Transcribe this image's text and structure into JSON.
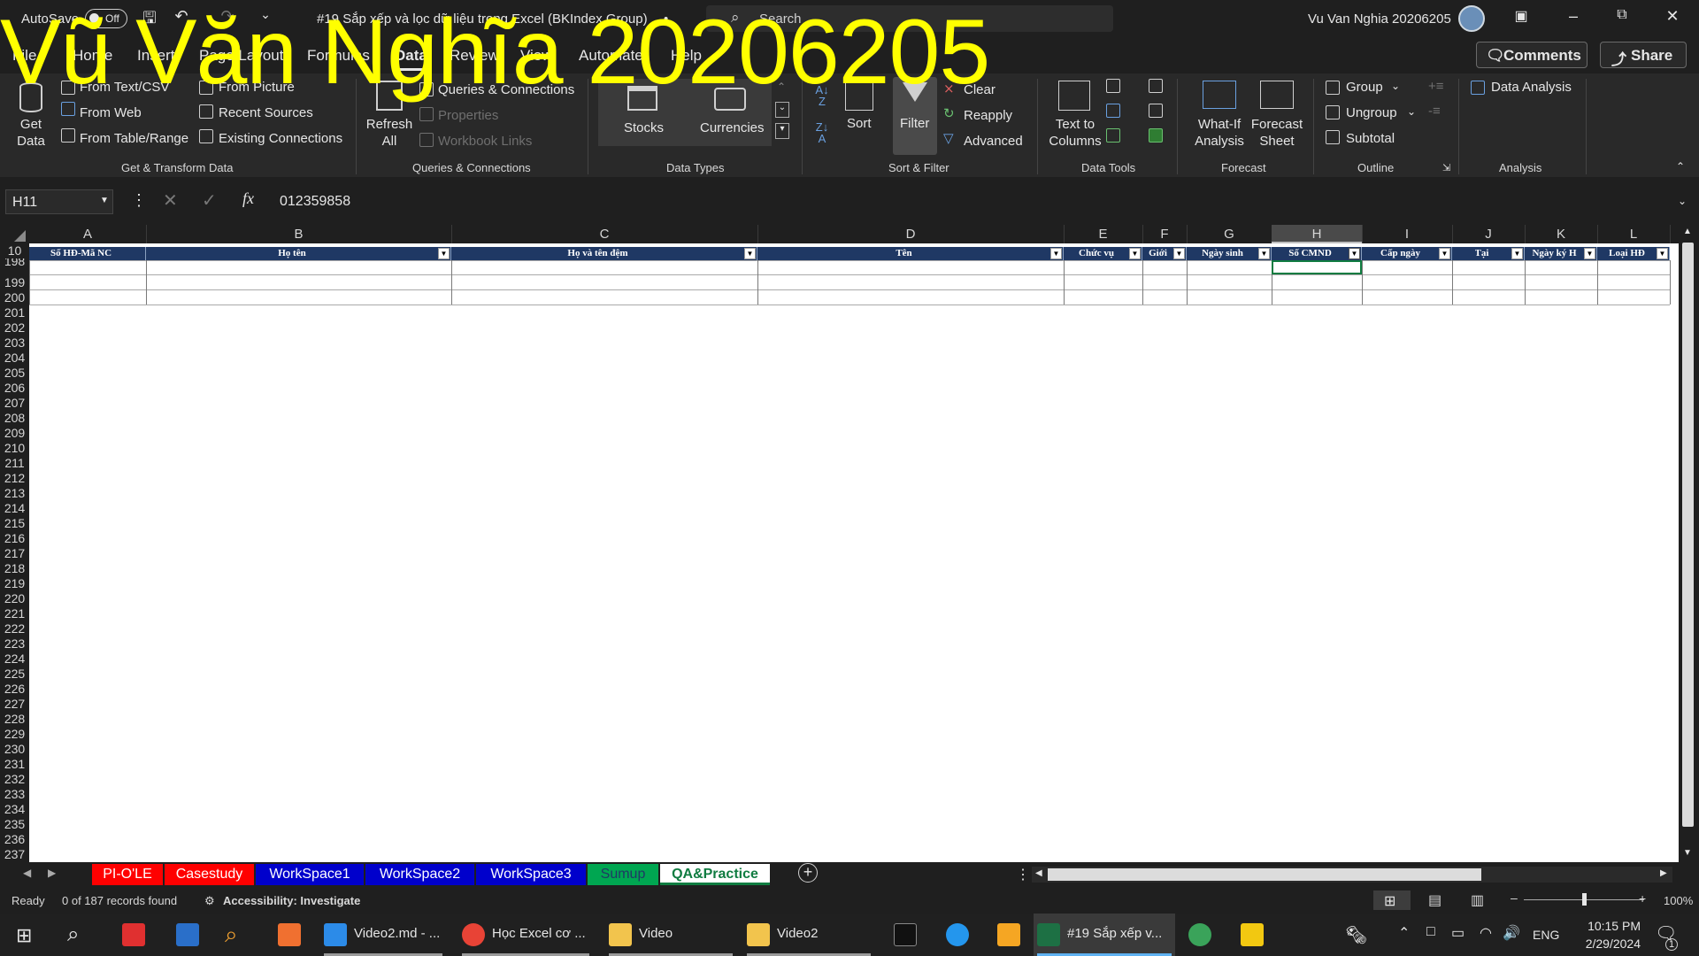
{
  "title_bar": {
    "autosave_label": "AutoSave",
    "autosave_state": "Off",
    "document_title": "#19 Sắp xếp và lọc dữ liệu trong Excel (BKIndex Group)",
    "saved_indicator": "•",
    "search_placeholder": "Search",
    "user_name": "Vu Van Nghia 20206205",
    "icons": [
      "save-icon",
      "undo-icon",
      "redo-icon",
      "customize-icon",
      "ribbon-display-icon",
      "minimize-icon",
      "restore-icon",
      "close-icon"
    ]
  },
  "menu": {
    "items": [
      "File",
      "Home",
      "Insert",
      "Page Layout",
      "Formulas",
      "Data",
      "Review",
      "View",
      "Automate",
      "Help"
    ],
    "active": "Data",
    "comments_label": "Comments",
    "share_label": "Share"
  },
  "ribbon": {
    "get_transform": {
      "get_data": "Get Data",
      "from_text_csv": "From Text/CSV",
      "from_web": "From Web",
      "from_table_range": "From Table/Range",
      "from_picture": "From Picture",
      "recent_sources": "Recent Sources",
      "existing_connections": "Existing Connections",
      "group_label": "Get & Transform Data"
    },
    "queries": {
      "refresh_all": "Refresh All",
      "queries_connections": "Queries & Connections",
      "properties": "Properties",
      "workbook_links": "Workbook Links",
      "group_label": "Queries & Connections"
    },
    "data_types": {
      "stocks": "Stocks",
      "currencies": "Currencies",
      "group_label": "Data Types"
    },
    "sort_filter": {
      "sort": "Sort",
      "filter": "Filter",
      "clear": "Clear",
      "reapply": "Reapply",
      "advanced": "Advanced",
      "group_label": "Sort & Filter"
    },
    "data_tools": {
      "text_to_columns": "Text to Columns",
      "group_label": "Data Tools"
    },
    "forecast": {
      "what_if": "What-If Analysis",
      "forecast_sheet": "Forecast Sheet",
      "group_label": "Forecast"
    },
    "outline": {
      "group": "Group",
      "ungroup": "Ungroup",
      "subtotal": "Subtotal",
      "group_label": "Outline"
    },
    "analysis": {
      "data_analysis": "Data Analysis",
      "group_label": "Analysis"
    }
  },
  "formula_bar": {
    "name_box": "H11",
    "fx_label": "fx",
    "value": "012359858"
  },
  "grid": {
    "columns": [
      "A",
      "B",
      "C",
      "D",
      "E",
      "F",
      "G",
      "H",
      "I",
      "J",
      "K",
      "L"
    ],
    "selected_column": "H",
    "header_row_number": "10",
    "table_headers": [
      "Số HĐ-Mã NC",
      "Họ tên",
      "Họ và tên đệm",
      "Tên",
      "Chức vụ",
      "Giới",
      "Ngày sinh",
      "Số CMND",
      "Cấp ngày",
      "Tại",
      "Ngày ký H",
      "Loại HĐ"
    ],
    "filtered_column": "Số CMND",
    "row_numbers": [
      "198",
      "199",
      "200",
      "201",
      "202",
      "203",
      "204",
      "205",
      "206",
      "207",
      "208",
      "209",
      "210",
      "211",
      "212",
      "213",
      "214",
      "215",
      "216",
      "217",
      "218",
      "219",
      "220",
      "221",
      "222",
      "223",
      "224",
      "225",
      "226",
      "227",
      "228",
      "229",
      "230",
      "231",
      "232",
      "233",
      "234",
      "235",
      "236",
      "237"
    ]
  },
  "sheet_tabs": [
    {
      "label": "PI-O'LE",
      "color": "#ff0000",
      "text_color": "#ffffff"
    },
    {
      "label": "Casestudy",
      "color": "#ff0000",
      "text_color": "#ffffff"
    },
    {
      "label": "WorkSpace1",
      "color": "#0000cc",
      "text_color": "#ffffff"
    },
    {
      "label": "WorkSpace2",
      "color": "#0000cc",
      "text_color": "#ffffff"
    },
    {
      "label": "WorkSpace3",
      "color": "#0000cc",
      "text_color": "#ffffff"
    },
    {
      "label": "Sumup",
      "color": "#00a651",
      "text_color": "#1f3864"
    },
    {
      "label": "QA&Practice",
      "color": "#ffffff",
      "text_color": "#107c41"
    }
  ],
  "status_bar": {
    "mode": "Ready",
    "records": "0 of 187 records found",
    "accessibility": "Accessibility: Investigate",
    "zoom": "100%",
    "zoom_level": 0.5
  },
  "taskbar": {
    "apps": [
      {
        "label": "Video2.md - ...",
        "icon": "vscode-icon"
      },
      {
        "label": "Học Excel cơ ...",
        "icon": "chrome-icon"
      },
      {
        "label": "Video",
        "icon": "folder-icon"
      },
      {
        "label": "Video2",
        "icon": "folder-icon"
      },
      {
        "label": "#19 Sắp xếp v...",
        "icon": "excel-icon"
      }
    ],
    "language": "ENG",
    "time": "10:15 PM",
    "date": "2/29/2024",
    "notifications": "1"
  },
  "watermark": "Vũ Văn Nghĩa 20206205",
  "accent_colors": {
    "table_header": "#1f3864",
    "selected_tab_text": "#107c41",
    "watermark": "#ffff00"
  }
}
